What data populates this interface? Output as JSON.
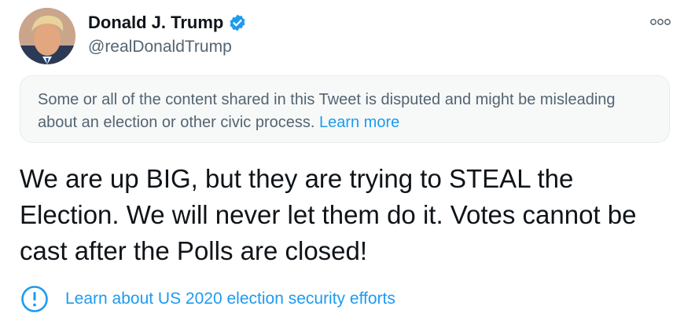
{
  "author": {
    "display_name": "Donald J. Trump",
    "handle": "@realDonaldTrump",
    "verified": true,
    "verified_color": "#1d9bf0"
  },
  "header": {
    "more_icon": "more-horizontal-icon"
  },
  "notice": {
    "text": "Some or all of the content shared in this Tweet is disputed and might be misleading about an election or other civic process.",
    "link_label": "Learn more"
  },
  "tweet": {
    "text": "We are up BIG, but they are trying to STEAL the Election. We will never let them do it. Votes cannot be cast after the Polls are closed!"
  },
  "election_info": {
    "icon": "info-circle-icon",
    "link_label": "Learn about US 2020 election security efforts"
  },
  "colors": {
    "accent": "#1d9bf0",
    "secondary_text": "#536471",
    "notice_background": "#f7f9f9"
  }
}
